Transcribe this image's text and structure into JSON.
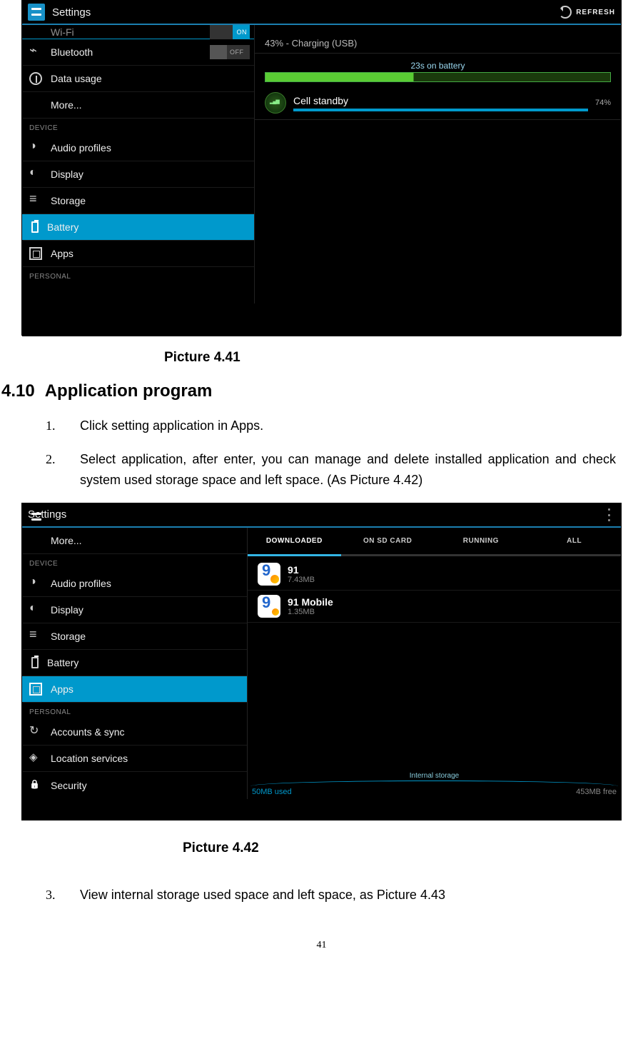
{
  "shot1": {
    "titlebar": {
      "title": "Settings",
      "refresh": "REFRESH"
    },
    "sidebar": {
      "wifi": "Wi-Fi",
      "wifi_toggle": "ON",
      "bluetooth": "Bluetooth",
      "bt_toggle": "OFF",
      "data_usage": "Data usage",
      "more": "More...",
      "header_device": "DEVICE",
      "audio": "Audio profiles",
      "display": "Display",
      "storage": "Storage",
      "battery": "Battery",
      "apps": "Apps",
      "header_personal": "PERSONAL"
    },
    "detail": {
      "status": "43% - Charging (USB)",
      "chart_label": "23s on battery",
      "item_name": "Cell standby",
      "item_pct": "74%"
    }
  },
  "shot2": {
    "titlebar": {
      "title": "Settings"
    },
    "sidebar": {
      "more": "More...",
      "header_device": "DEVICE",
      "audio": "Audio profiles",
      "display": "Display",
      "storage": "Storage",
      "battery": "Battery",
      "apps": "Apps",
      "header_personal": "PERSONAL",
      "accounts": "Accounts & sync",
      "location": "Location services",
      "security": "Security"
    },
    "tabs": {
      "downloaded": "DOWNLOADED",
      "sdcard": "ON SD CARD",
      "running": "RUNNING",
      "all": "ALL"
    },
    "apps": [
      {
        "name": "91",
        "size": "7.43MB"
      },
      {
        "name": "91 Mobile",
        "size": "1.35MB"
      }
    ],
    "storage": {
      "label": "Internal storage",
      "used": "50MB used",
      "free": "453MB free"
    }
  },
  "doc": {
    "caption1": "Picture 4.41",
    "heading_num": "4.10",
    "heading_text": "Application program",
    "list": {
      "i1_num": "1.",
      "i1_txt": "Click setting application in Apps.",
      "i2_num": "2.",
      "i2_txt": "Select application, after enter, you can manage and delete installed application and check system used storage space and left space. (As Picture 4.42)",
      "i3_num": "3.",
      "i3_txt": "View internal storage used space and left space, as Picture 4.43"
    },
    "caption2": "Picture 4.42",
    "page_number": "41"
  }
}
